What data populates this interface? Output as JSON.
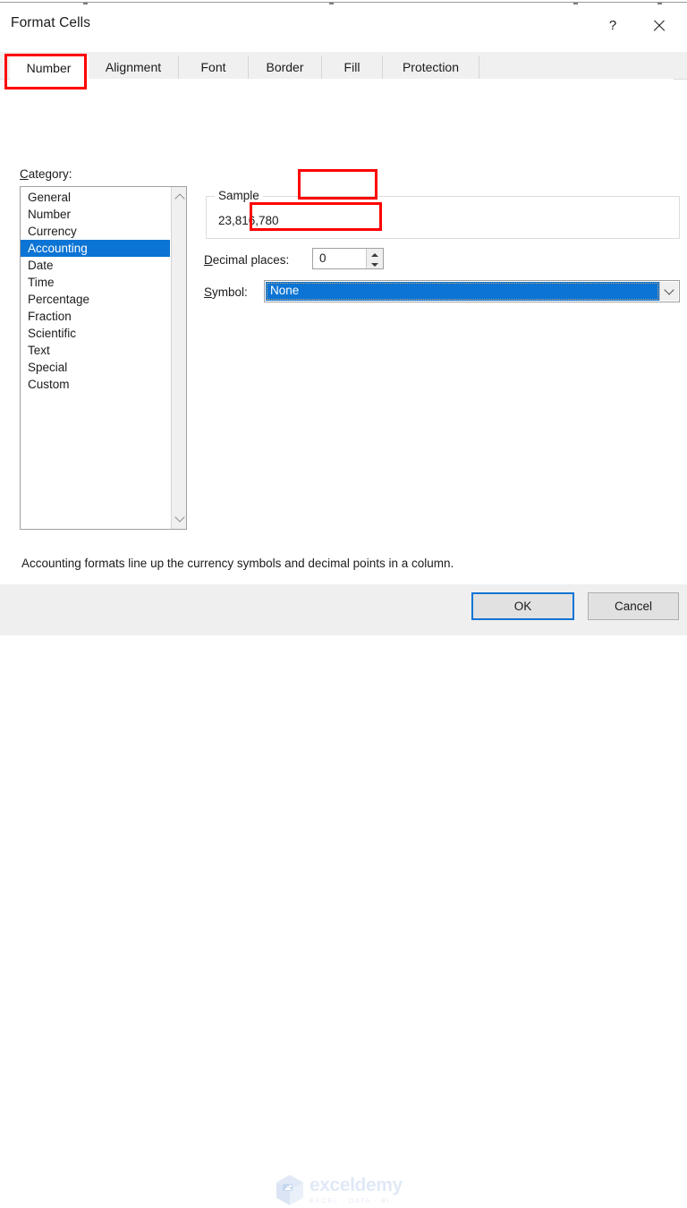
{
  "window": {
    "title": "Format Cells",
    "help_icon": "question-mark-icon",
    "close_icon": "close-icon"
  },
  "tabs": [
    {
      "label": "Number",
      "active": true
    },
    {
      "label": "Alignment",
      "active": false
    },
    {
      "label": "Font",
      "active": false
    },
    {
      "label": "Border",
      "active": false
    },
    {
      "label": "Fill",
      "active": false
    },
    {
      "label": "Protection",
      "active": false
    }
  ],
  "category": {
    "label_accel": "C",
    "label_rest": "ategory:",
    "items": [
      "General",
      "Number",
      "Currency",
      "Accounting",
      "Date",
      "Time",
      "Percentage",
      "Fraction",
      "Scientific",
      "Text",
      "Special",
      "Custom"
    ],
    "selected": "Accounting",
    "scroll_up_icon": "chevron-up-icon",
    "scroll_down_icon": "chevron-down-icon"
  },
  "sample": {
    "legend": "Sample",
    "value": "23,816,780"
  },
  "decimal_places": {
    "label_accel": "D",
    "label_rest": "ecimal places:",
    "value": "0",
    "increment_icon": "spinner-up-icon",
    "decrement_icon": "spinner-down-icon"
  },
  "symbol": {
    "label_accel": "S",
    "label_rest": "ymbol:",
    "value": "None",
    "dropdown_icon": "chevron-down-icon"
  },
  "description": "Accounting formats line up the currency symbols and decimal points in a column.",
  "footer": {
    "ok_label": "OK",
    "cancel_label": "Cancel"
  },
  "watermark": {
    "name": "exceldemy",
    "tagline": "EXCEL · DATA · BI"
  },
  "colors": {
    "selection_blue": "#0c74d4",
    "focus_blue": "#0078d7",
    "annotation_red": "#ff0000",
    "dialog_bg": "#ffffff",
    "footer_bg": "#efefef"
  }
}
